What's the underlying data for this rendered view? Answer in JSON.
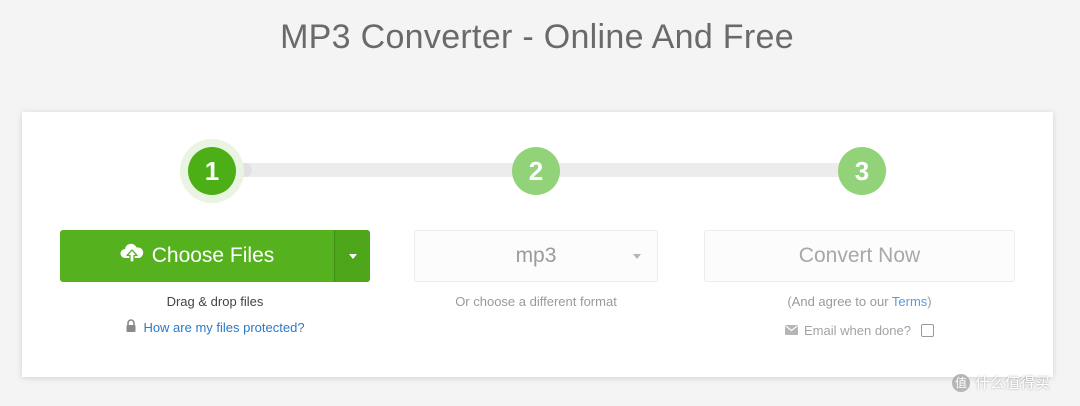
{
  "page": {
    "title": "MP3 Converter - Online And Free"
  },
  "steps": {
    "items": [
      {
        "number": "1",
        "state": "active"
      },
      {
        "number": "2",
        "state": "inactive"
      },
      {
        "number": "3",
        "state": "inactive"
      }
    ],
    "colors": {
      "active": "#4caf16",
      "inactive": "#92d278"
    }
  },
  "upload": {
    "button_label": "Choose Files",
    "button_icon": "cloud-upload-icon",
    "dropdown_icon": "caret-down-icon",
    "drag_text": "Drag & drop files",
    "protected_link": "How are my files protected?",
    "protected_icon": "lock-icon",
    "accent_color": "#56b11f"
  },
  "format": {
    "selected": "mp3",
    "hint": "Or choose a different format"
  },
  "convert": {
    "button_label": "Convert Now",
    "terms_prefix": "(And agree to our ",
    "terms_link": "Terms",
    "terms_suffix": ")",
    "email_label": "Email when done?",
    "email_icon": "envelope-icon",
    "email_checked": false
  },
  "watermark": {
    "logo_text": "值",
    "text": "什么值得买"
  }
}
